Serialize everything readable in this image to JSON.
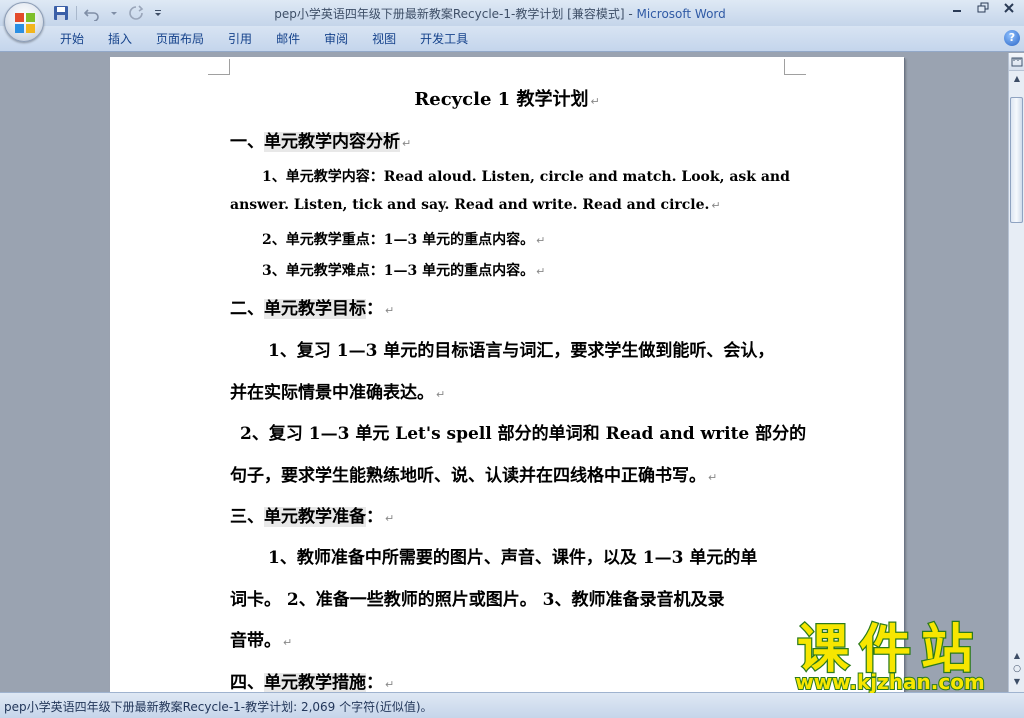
{
  "window": {
    "title_doc": "pep小学英语四年级下册最新教案Recycle-1-教学计划 [兼容模式] - ",
    "title_app": "Microsoft Word"
  },
  "quick_access": {
    "icons": [
      "save-icon",
      "undo-icon",
      "redo-icon",
      "customize-icon"
    ]
  },
  "ribbon": {
    "tabs": [
      "开始",
      "插入",
      "页面布局",
      "引用",
      "邮件",
      "审阅",
      "视图",
      "开发工具"
    ],
    "help": "?"
  },
  "document": {
    "title": "Recycle 1  教学计划",
    "s1_heading_num": "一、",
    "s1_heading": "单元教学内容分析",
    "s1_item1_a": "1、单元教学内容：Read aloud. Listen, circle and match. Look, ask and",
    "s1_item1_b": "answer. Listen, tick and say. Read and write. Read and circle.",
    "s1_item2": "2、单元教学重点：1—3 单元的重点内容。",
    "s1_item3": "3、单元教学难点：1—3 单元的重点内容。",
    "s2_heading_num": "二、",
    "s2_heading": "单元教学目标",
    "s2_heading_tail": "：",
    "s2_p1_a": "1、复习 1—3 单元的目标语言与词汇，要求学生做到能听、会认，",
    "s2_p1_b": "并在实际情景中准确表达。",
    "s2_p2_a": "2、复习 1—3 单元 Let's spell 部分的单词和 Read and write 部分的",
    "s2_p2_b": "句子，要求学生能熟练地听、说、认读并在四线格中正确书写。",
    "s3_heading_num": "三、",
    "s3_heading": "单元教学准备",
    "s3_heading_tail": "：",
    "s3_p1_a": "1、教师准备中所需要的图片、声音、课件，以及 1—3 单元的单",
    "s3_p1_b": "词卡。   2、准备一些教师的照片或图片。   3、教师准备录音机及录",
    "s3_p1_c": "音带。",
    "s4_heading_num": "四、",
    "s4_heading": "单元教学措施",
    "s4_heading_tail": "：",
    "para_mark": "↵"
  },
  "scrollbar": {
    "ruler_icon": "ruler-icon",
    "up": "▲",
    "prev": "▲",
    "browse": "○",
    "next": "▼"
  },
  "status": {
    "text": "pep小学英语四年级下册最新教案Recycle-1-教学计划: 2,069 个字符(近似值)。"
  },
  "watermark": {
    "brand": "课件站",
    "url": "www.kjzhan.com"
  },
  "colors": {
    "watermark_fill": "#f7e600",
    "watermark_stroke": "#2c7a1c",
    "title_app": "#2f5aa5",
    "tab_text": "#15428b"
  }
}
